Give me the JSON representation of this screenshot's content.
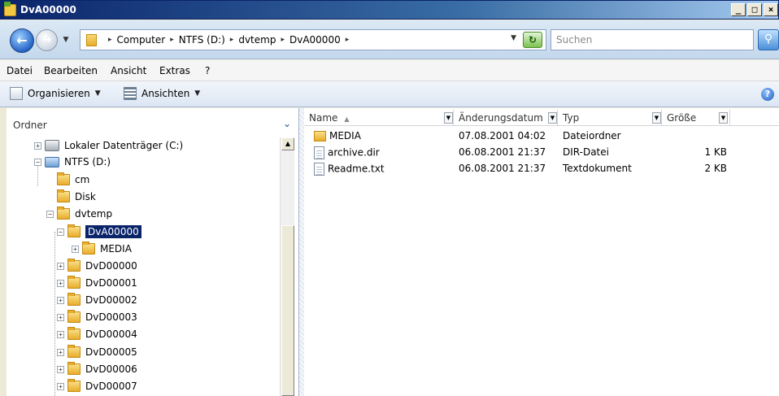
{
  "window": {
    "title": "DvA00000",
    "controls": [
      "_",
      "□",
      "×"
    ]
  },
  "address": {
    "breadcrumb": [
      "Computer",
      "NTFS (D:)",
      "dvtemp",
      "DvA00000"
    ],
    "search_placeholder": "Suchen"
  },
  "menu": [
    "Datei",
    "Bearbeiten",
    "Ansicht",
    "Extras",
    "?"
  ],
  "toolbar": {
    "organize": "Organisieren",
    "views": "Ansichten"
  },
  "tree": {
    "header": "Ordner",
    "items": [
      {
        "label": "Lokaler Datenträger (C:)",
        "level": 0,
        "expander": "+",
        "icon": "drive-icon"
      },
      {
        "label": "NTFS (D:)",
        "level": 0,
        "expander": "−",
        "icon": "network-drive-icon"
      },
      {
        "label": "cm",
        "level": 1,
        "expander": "",
        "icon": "folder-icon"
      },
      {
        "label": "Disk",
        "level": 1,
        "expander": "",
        "icon": "folder-icon"
      },
      {
        "label": "dvtemp",
        "level": 1,
        "expander": "−",
        "icon": "folder-icon"
      },
      {
        "label": "DvA00000",
        "level": 2,
        "expander": "−",
        "icon": "folder-icon",
        "selected": true
      },
      {
        "label": "MEDIA",
        "level": 3,
        "expander": "+",
        "icon": "folder-icon"
      },
      {
        "label": "DvD00000",
        "level": 2,
        "expander": "+",
        "icon": "folder-icon"
      },
      {
        "label": "DvD00001",
        "level": 2,
        "expander": "+",
        "icon": "folder-icon"
      },
      {
        "label": "DvD00002",
        "level": 2,
        "expander": "+",
        "icon": "folder-icon"
      },
      {
        "label": "DvD00003",
        "level": 2,
        "expander": "+",
        "icon": "folder-icon"
      },
      {
        "label": "DvD00004",
        "level": 2,
        "expander": "+",
        "icon": "folder-icon"
      },
      {
        "label": "DvD00005",
        "level": 2,
        "expander": "+",
        "icon": "folder-icon"
      },
      {
        "label": "DvD00006",
        "level": 2,
        "expander": "+",
        "icon": "folder-icon"
      },
      {
        "label": "DvD00007",
        "level": 2,
        "expander": "+",
        "icon": "folder-icon"
      }
    ]
  },
  "filelist": {
    "columns": {
      "name": "Name",
      "date": "Änderungsdatum",
      "type": "Typ",
      "size": "Größe"
    },
    "rows": [
      {
        "name": "MEDIA",
        "date": "07.08.2001 04:02",
        "type": "Dateiordner",
        "size": "",
        "icon": "folder-icon"
      },
      {
        "name": "archive.dir",
        "date": "06.08.2001 21:37",
        "type": "DIR-Datei",
        "size": "1 KB",
        "icon": "file-icon"
      },
      {
        "name": "Readme.txt",
        "date": "06.08.2001 21:37",
        "type": "Textdokument",
        "size": "2 KB",
        "icon": "text-file-icon"
      }
    ]
  }
}
